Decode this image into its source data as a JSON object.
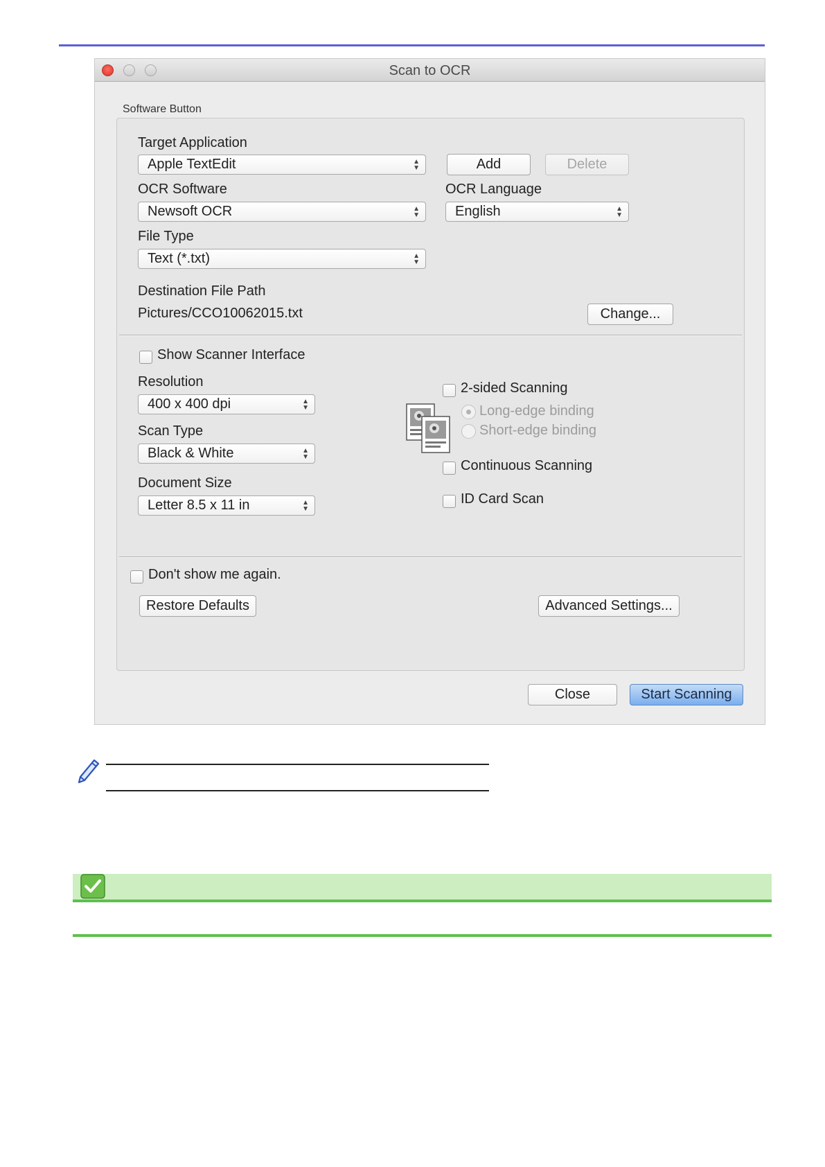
{
  "window": {
    "title": "Scan to OCR"
  },
  "software_button": {
    "group_label": "Software Button",
    "target_application": {
      "label": "Target Application",
      "value": "Apple TextEdit"
    },
    "add_label": "Add",
    "delete_label": "Delete",
    "ocr_software": {
      "label": "OCR Software",
      "value": "Newsoft OCR"
    },
    "ocr_language": {
      "label": "OCR Language",
      "value": "English"
    },
    "file_type": {
      "label": "File Type",
      "value": "Text (*.txt)"
    },
    "destination": {
      "label": "Destination File Path",
      "value": "Pictures/CCO10062015.txt"
    },
    "change_label": "Change..."
  },
  "scan_settings": {
    "show_scanner_interface": {
      "label": "Show Scanner Interface",
      "checked": false
    },
    "resolution": {
      "label": "Resolution",
      "value": "400 x 400 dpi"
    },
    "scan_type": {
      "label": "Scan Type",
      "value": "Black & White"
    },
    "document_size": {
      "label": "Document Size",
      "value": "Letter 8.5 x 11 in"
    },
    "two_sided": {
      "label": "2-sided Scanning",
      "checked": false
    },
    "long_edge": {
      "label": "Long-edge binding",
      "selected": true,
      "enabled": false
    },
    "short_edge": {
      "label": "Short-edge binding",
      "selected": false,
      "enabled": false
    },
    "continuous": {
      "label": "Continuous Scanning",
      "checked": false
    },
    "id_card": {
      "label": "ID Card Scan",
      "checked": false
    }
  },
  "footer": {
    "dont_show": {
      "label": "Don't show me again.",
      "checked": false
    },
    "restore_label": "Restore Defaults",
    "advanced_label": "Advanced Settings...",
    "close_label": "Close",
    "start_label": "Start Scanning"
  },
  "colors": {
    "accent_rule": "#5b5fd6",
    "related_bar": "#cdeec0",
    "related_line": "#5ec04e",
    "primary_button": "#7aaeee"
  }
}
